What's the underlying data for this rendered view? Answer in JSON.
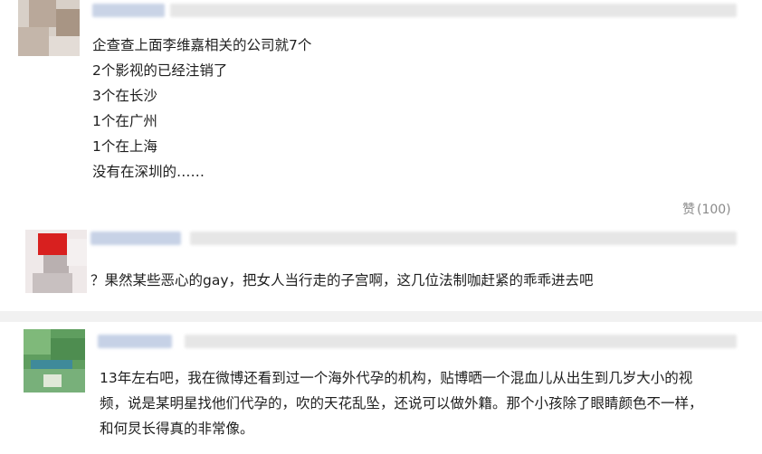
{
  "comments": [
    {
      "lines": [
        "企查查上面李维嘉相关的公司就7个",
        "2个影视的已经注销了",
        "3个在长沙",
        "1个在广州",
        "1个在上海",
        "没有在深圳的……"
      ],
      "like_icon": "赞",
      "like_count": "(100)"
    },
    {
      "lines": [
        "？果然某些恶心的gay，把女人当行走的子宫啊，这几位法制咖赶紧的乖乖进去吧"
      ]
    },
    {
      "lines": [
        "13年左右吧，我在微博还看到过一个海外代孕的机构，贴博晒一个混血儿从出生到几岁大小的视",
        "频，说是某明星找他们代孕的，吹的天花乱坠，还说可以做外籍。那个小孩除了眼睛颜色不一样，",
        "和何炅长得真的非常像。"
      ]
    }
  ]
}
